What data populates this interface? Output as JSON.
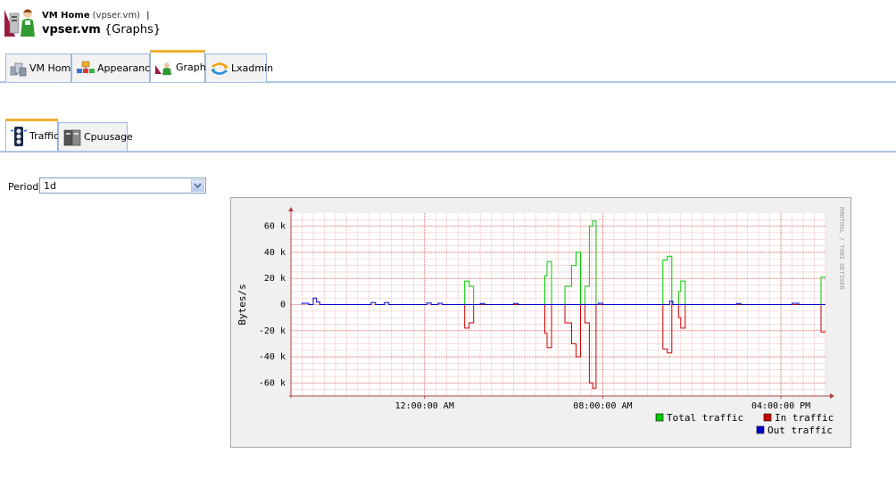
{
  "header": {
    "breadcrumb_home": "VM Home",
    "breadcrumb_home_sub": "(vpser.vm)",
    "breadcrumb_sep": "|",
    "title_main": "vpser.vm",
    "title_sub": "{Graphs}"
  },
  "tabs": [
    {
      "label": "VM Home",
      "icon": "vm-home-icon",
      "active": false
    },
    {
      "label": "Appearance",
      "icon": "appearance-icon",
      "active": false
    },
    {
      "label": "Graphs",
      "icon": "graphs-icon",
      "active": true
    },
    {
      "label": "Lxadmin",
      "icon": "lxadmin-icon",
      "active": false
    }
  ],
  "subtabs": [
    {
      "label": "Traffic",
      "icon": "traffic-icon",
      "active": true
    },
    {
      "label": "Cpuusage",
      "icon": "cpuusage-icon",
      "active": false
    }
  ],
  "period": {
    "label": "Period",
    "value": "1d"
  },
  "chart_data": {
    "type": "line",
    "ylabel": "Bytes/s",
    "watermark": "RRDTOOL / TOBI OETIKER",
    "ylim": [
      -70000,
      70000
    ],
    "y_ticks": [
      {
        "value": 60000,
        "label": "60 k"
      },
      {
        "value": 40000,
        "label": "40 k"
      },
      {
        "value": 20000,
        "label": "20 k"
      },
      {
        "value": 0,
        "label": "0"
      },
      {
        "value": -20000,
        "label": "-20 k"
      },
      {
        "value": -40000,
        "label": "-40 k"
      },
      {
        "value": -60000,
        "label": "-60 k"
      }
    ],
    "x_range_hours": [
      0,
      24
    ],
    "x_ticks": [
      {
        "hour": 6,
        "label": "12:00:00 AM"
      },
      {
        "hour": 14,
        "label": "08:00:00 AM"
      },
      {
        "hour": 22,
        "label": "04:00:00 PM"
      }
    ],
    "grid": true,
    "legend_position": "bottom-right",
    "legend": [
      {
        "name": "Total traffic",
        "color": "#00cc00"
      },
      {
        "name": "In traffic",
        "color": "#cc0000"
      },
      {
        "name": "Out traffic",
        "color": "#0000cc"
      }
    ],
    "series": [
      {
        "name": "Total traffic",
        "color": "#00cc00",
        "points": [
          [
            7.8,
            0
          ],
          [
            7.8,
            18000
          ],
          [
            8.0,
            18000
          ],
          [
            8.0,
            14000
          ],
          [
            8.2,
            14000
          ],
          [
            8.2,
            0
          ],
          [
            11.4,
            0
          ],
          [
            11.4,
            22000
          ],
          [
            11.5,
            22000
          ],
          [
            11.5,
            33000
          ],
          [
            11.7,
            33000
          ],
          [
            11.7,
            0
          ],
          [
            12.3,
            0
          ],
          [
            12.3,
            14000
          ],
          [
            12.6,
            14000
          ],
          [
            12.6,
            30000
          ],
          [
            12.8,
            30000
          ],
          [
            12.8,
            40000
          ],
          [
            13.0,
            40000
          ],
          [
            13.0,
            0
          ],
          [
            13.2,
            0
          ],
          [
            13.2,
            14000
          ],
          [
            13.4,
            14000
          ],
          [
            13.4,
            60000
          ],
          [
            13.55,
            60000
          ],
          [
            13.55,
            64000
          ],
          [
            13.7,
            64000
          ],
          [
            13.7,
            0
          ],
          [
            16.7,
            0
          ],
          [
            16.7,
            34000
          ],
          [
            16.9,
            34000
          ],
          [
            16.9,
            37000
          ],
          [
            17.1,
            37000
          ],
          [
            17.1,
            0
          ],
          [
            17.4,
            0
          ],
          [
            17.4,
            10000
          ],
          [
            17.5,
            10000
          ],
          [
            17.5,
            18000
          ],
          [
            17.7,
            18000
          ],
          [
            17.7,
            0
          ],
          [
            23.8,
            0
          ],
          [
            23.8,
            21000
          ],
          [
            24.0,
            21000
          ]
        ]
      },
      {
        "name": "In traffic",
        "color": "#cc0000",
        "points": [
          [
            7.8,
            0
          ],
          [
            7.8,
            -18000
          ],
          [
            8.0,
            -18000
          ],
          [
            8.0,
            -14000
          ],
          [
            8.2,
            -14000
          ],
          [
            8.2,
            0
          ],
          [
            11.4,
            0
          ],
          [
            11.4,
            -22000
          ],
          [
            11.5,
            -22000
          ],
          [
            11.5,
            -33000
          ],
          [
            11.7,
            -33000
          ],
          [
            11.7,
            0
          ],
          [
            12.3,
            0
          ],
          [
            12.3,
            -14000
          ],
          [
            12.6,
            -14000
          ],
          [
            12.6,
            -30000
          ],
          [
            12.8,
            -30000
          ],
          [
            12.8,
            -40000
          ],
          [
            13.0,
            -40000
          ],
          [
            13.0,
            0
          ],
          [
            13.2,
            0
          ],
          [
            13.2,
            -14000
          ],
          [
            13.4,
            -14000
          ],
          [
            13.4,
            -60000
          ],
          [
            13.55,
            -60000
          ],
          [
            13.55,
            -64000
          ],
          [
            13.7,
            -64000
          ],
          [
            13.7,
            0
          ],
          [
            16.7,
            0
          ],
          [
            16.7,
            -34000
          ],
          [
            16.9,
            -34000
          ],
          [
            16.9,
            -37000
          ],
          [
            17.1,
            -37000
          ],
          [
            17.1,
            0
          ],
          [
            17.4,
            0
          ],
          [
            17.4,
            -10000
          ],
          [
            17.5,
            -10000
          ],
          [
            17.5,
            -18000
          ],
          [
            17.7,
            -18000
          ],
          [
            17.7,
            0
          ],
          [
            23.8,
            0
          ],
          [
            23.8,
            -21000
          ],
          [
            24.0,
            -21000
          ]
        ]
      },
      {
        "name": "Out traffic",
        "color": "#0000cc",
        "points": [
          [
            0.5,
            0
          ],
          [
            0.5,
            1000
          ],
          [
            0.8,
            1000
          ],
          [
            0.8,
            0
          ],
          [
            1.0,
            0
          ],
          [
            1.0,
            5000
          ],
          [
            1.15,
            5000
          ],
          [
            1.15,
            2000
          ],
          [
            1.3,
            2000
          ],
          [
            1.3,
            0
          ],
          [
            3.6,
            0
          ],
          [
            3.6,
            1500
          ],
          [
            3.8,
            1500
          ],
          [
            3.8,
            0
          ],
          [
            4.2,
            0
          ],
          [
            4.2,
            1500
          ],
          [
            4.4,
            1500
          ],
          [
            4.4,
            0
          ],
          [
            6.1,
            0
          ],
          [
            6.1,
            1200
          ],
          [
            6.3,
            1200
          ],
          [
            6.3,
            0
          ],
          [
            6.6,
            0
          ],
          [
            6.6,
            1000
          ],
          [
            6.8,
            1000
          ],
          [
            6.8,
            0
          ],
          [
            8.5,
            0
          ],
          [
            8.5,
            800
          ],
          [
            8.7,
            800
          ],
          [
            8.7,
            0
          ],
          [
            10.0,
            0
          ],
          [
            10.0,
            800
          ],
          [
            10.2,
            800
          ],
          [
            10.2,
            0
          ],
          [
            13.8,
            0
          ],
          [
            13.8,
            1000
          ],
          [
            14.0,
            1000
          ],
          [
            14.0,
            0
          ],
          [
            17.0,
            0
          ],
          [
            17.0,
            2500
          ],
          [
            17.15,
            2500
          ],
          [
            17.15,
            0
          ],
          [
            20.0,
            0
          ],
          [
            20.0,
            800
          ],
          [
            20.2,
            800
          ],
          [
            20.2,
            0
          ],
          [
            22.5,
            0
          ],
          [
            22.5,
            1000
          ],
          [
            22.8,
            1000
          ],
          [
            22.8,
            0
          ],
          [
            24.0,
            0
          ]
        ]
      }
    ]
  }
}
